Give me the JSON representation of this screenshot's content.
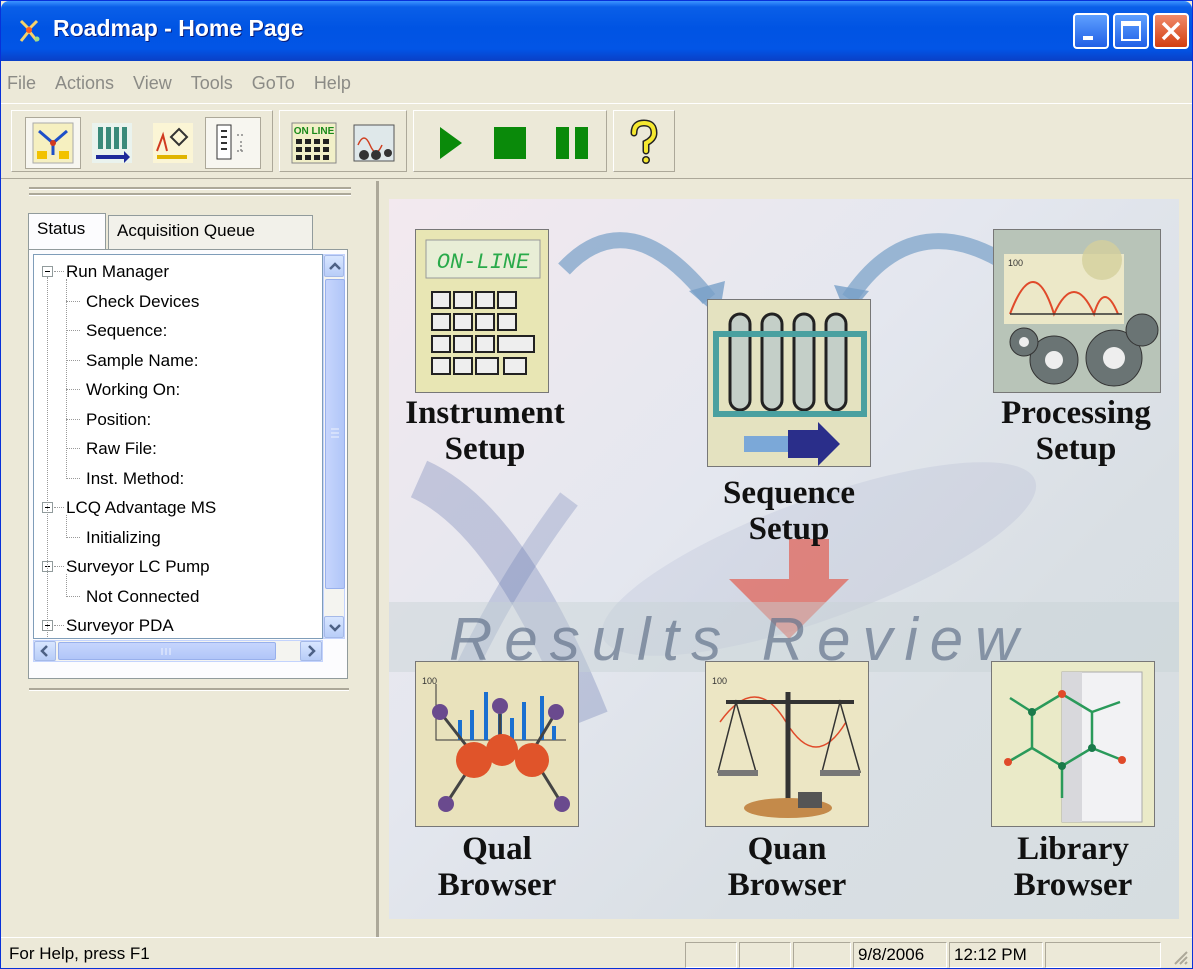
{
  "window": {
    "title": "Roadmap - Home Page",
    "title_bar_color": "#0054e3"
  },
  "menu": [
    "File",
    "Actions",
    "View",
    "Tools",
    "GoTo",
    "Help"
  ],
  "toolbar": {
    "group1": [
      {
        "icon": "roadmap-view-icon",
        "pressed": true
      },
      {
        "icon": "sequence-view-icon",
        "pressed": false
      },
      {
        "icon": "processing-view-icon",
        "pressed": false
      },
      {
        "icon": "status-panel-icon",
        "pressed": true
      }
    ],
    "group2": [
      {
        "icon": "online-view-icon",
        "text": "ON LINE"
      },
      {
        "icon": "instrument-status-icon"
      }
    ],
    "group3": [
      {
        "icon": "run-icon"
      },
      {
        "icon": "stop-icon"
      },
      {
        "icon": "pause-icon"
      }
    ],
    "help_icon": "help-icon"
  },
  "left_panel": {
    "tabs": [
      "Status",
      "Acquisition Queue"
    ],
    "active_tab": "Status",
    "tree": [
      {
        "label": "Run Manager",
        "level": 0
      },
      {
        "label": "Check Devices",
        "level": 1
      },
      {
        "label": "Sequence:",
        "level": 1
      },
      {
        "label": "Sample Name:",
        "level": 1
      },
      {
        "label": "Working On:",
        "level": 1
      },
      {
        "label": "Position:",
        "level": 1
      },
      {
        "label": "Raw File:",
        "level": 1
      },
      {
        "label": "Inst. Method:",
        "level": 1
      },
      {
        "label": "LCQ Advantage MS",
        "level": 0
      },
      {
        "label": "Initializing",
        "level": 1
      },
      {
        "label": "Surveyor LC Pump",
        "level": 0
      },
      {
        "label": "Not Connected",
        "level": 1
      },
      {
        "label": "Surveyor PDA",
        "level": 0
      }
    ]
  },
  "roadmap": {
    "instrument_setup": {
      "label_line1": "Instrument",
      "label_line2": "Setup",
      "screen_text": "ON-LINE"
    },
    "sequence_setup": {
      "label_line1": "Sequence",
      "label_line2": "Setup"
    },
    "processing_setup": {
      "label_line1": "Processing",
      "label_line2": "Setup"
    },
    "results_review": "Results Review",
    "qual_browser": {
      "label_line1": "Qual",
      "label_line2": "Browser"
    },
    "quan_browser": {
      "label_line1": "Quan",
      "label_line2": "Browser"
    },
    "library_browser": {
      "label_line1": "Library",
      "label_line2": "Browser"
    },
    "axis_label": "100"
  },
  "statusbar": {
    "help_text": "For Help, press F1",
    "date": "9/8/2006",
    "time": "12:12 PM"
  }
}
